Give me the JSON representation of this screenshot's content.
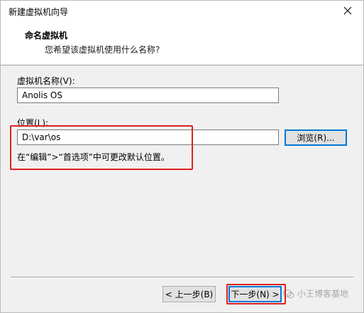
{
  "window": {
    "title": "新建虚拟机向导"
  },
  "header": {
    "title": "命名虚拟机",
    "subtitle": "您希望该虚拟机使用什么名称?"
  },
  "form": {
    "name_label": "虚拟机名称(V):",
    "name_value": "Anolis OS",
    "location_label": "位置(L):",
    "location_value": "D:\\var\\os",
    "browse_label": "浏览(R)...",
    "hint": "在“编辑”>“首选项”中可更改默认位置。"
  },
  "footer": {
    "back_label": "< 上一步(B)",
    "next_label": "下一步(N) >"
  },
  "watermark": {
    "text": "小王博客基地"
  },
  "colors": {
    "highlight": "#e02020",
    "focus": "#0078d7",
    "dialog_bg": "#f0f0f0"
  }
}
